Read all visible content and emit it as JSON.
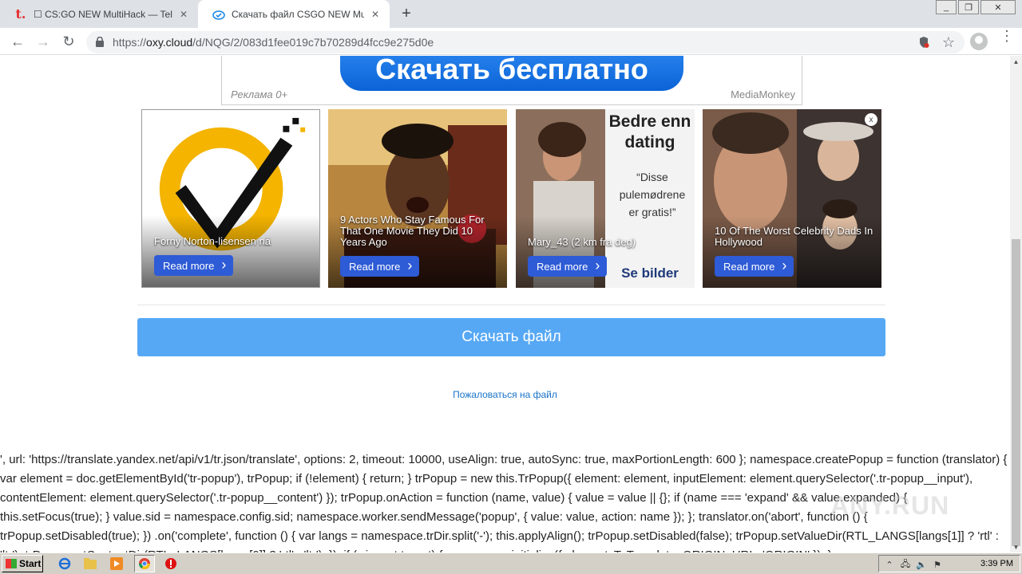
{
  "browser": {
    "tabs": [
      {
        "title": "☐ CS:GO NEW MultiHack — Teletype",
        "close_icon": "close-icon"
      },
      {
        "title": "Скачать файл CSGO NEW MultiHack",
        "close_icon": "close-icon"
      }
    ],
    "url_scheme": "https://",
    "url_host": "oxy.cloud",
    "url_path": "/d/NQG/2/083d1fee019c7b70289d4fcc9e275d0e"
  },
  "ad_banner": {
    "cta": "Скачать бесплатно",
    "label": "Реклама 0+",
    "brand": "MediaMonkey"
  },
  "ad_cards": [
    {
      "title": "Forny Norton-lisensen nå",
      "button": "Read more"
    },
    {
      "title": "9 Actors Who Stay Famous For That One Movie They Did 10 Years Ago",
      "button": "Read more"
    },
    {
      "title": "Mary_43 (2 km fra deg)",
      "button": "Read more",
      "side_text": [
        "Bedre enn",
        "dating",
        "“Disse pulemødrene er gratis!”",
        "Se bilder"
      ]
    },
    {
      "title": "10 Of The Worst Celebrity Dads In Hollywood",
      "button": "Read more"
    }
  ],
  "ad_info_glyph": "i",
  "ad_close_glyph": "x",
  "download_button": "Скачать файл",
  "complain_link": "Пожаловаться на файл",
  "code_dump": "', url: 'https://translate.yandex.net/api/v1/tr.json/translate', options: 2, timeout: 10000, useAlign: true, autoSync: true, maxPortionLength: 600 }; namespace.createPopup = function (translator) { var element = doc.getElementById('tr-popup'), trPopup; if (!element) { return; } trPopup = new this.TrPopup({ element: element, inputElement: element.querySelector('.tr-popup__input'), contentElement: element.querySelector('.tr-popup__content') }); trPopup.onAction = function (name, value) { value = value || {}; if (name === 'expand' && value.expanded) { this.setFocus(true); } value.sid = namespace.config.sid; namespace.worker.sendMessage('popup', { value: value, action: name }); }; translator.on('abort', function () { trPopup.setDisabled(true); }) .on('complete', function () { var langs = namespace.trDir.split('-'); this.applyAlign(); trPopup.setDisabled(false); trPopup.setValueDir(RTL_LANGS[langs[1]] ? 'rtl' : 'ltr'); trPopup.setContentDir(RTL_LANGS[langs[0]] ? 'rtl' : 'ltr'); }); if (wineset.target) { namespace.initialize({ elementsToTranslate, ORIGIN_URL: 'ORIGIN' }); }",
  "watermark": "ANY.RUN",
  "taskbar": {
    "start": "Start",
    "clock": "3:39 PM"
  }
}
